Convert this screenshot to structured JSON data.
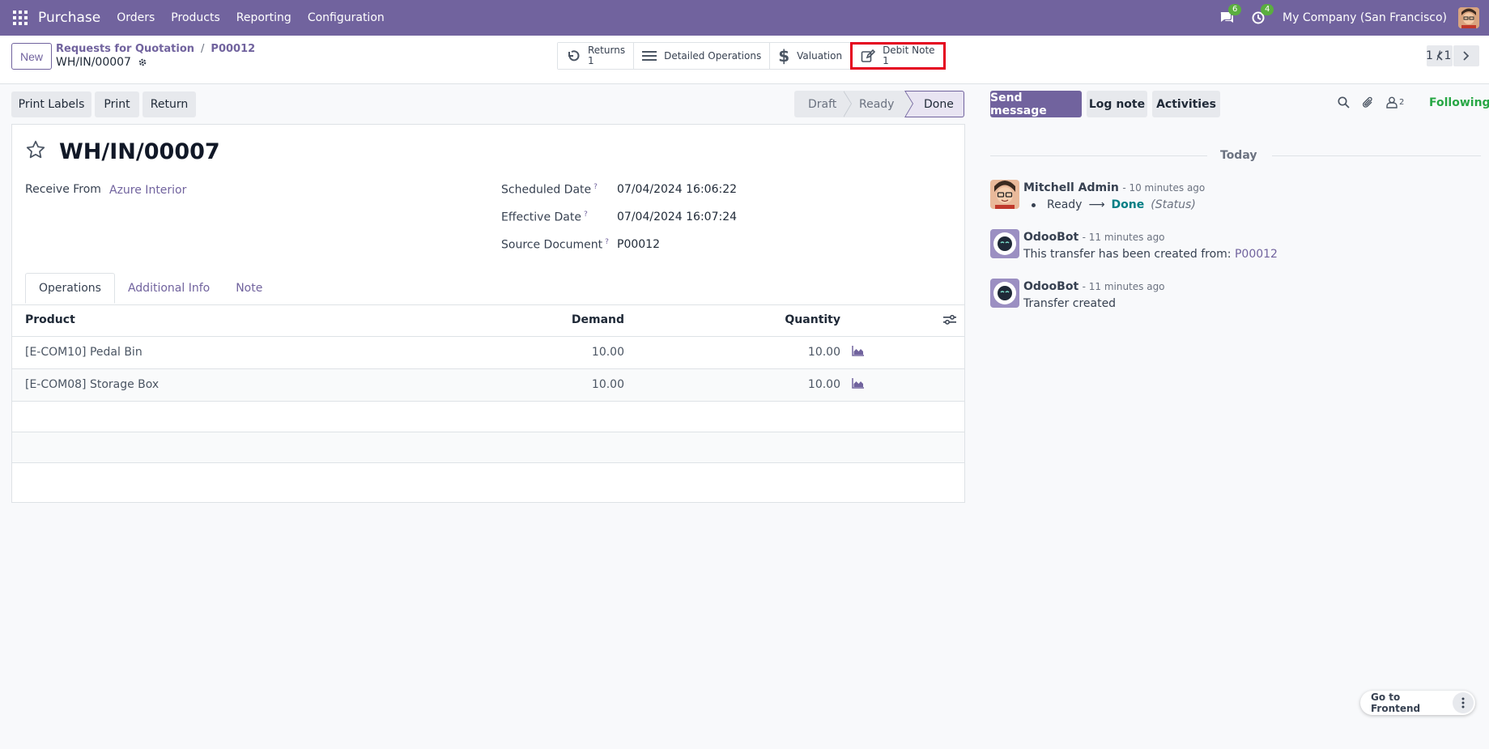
{
  "navbar": {
    "brand": "Purchase",
    "menu": [
      "Orders",
      "Products",
      "Reporting",
      "Configuration"
    ],
    "messages_count": "6",
    "activities_count": "4",
    "company": "My Company (San Francisco)"
  },
  "control": {
    "new_label": "New",
    "breadcrumb": [
      "Requests for Quotation",
      "P00012"
    ],
    "breadcrumb_sep": "/",
    "record_name": "WH/IN/00007",
    "smart_buttons": {
      "returns_label": "Returns",
      "returns_count": "1",
      "detailed_operations": "Detailed Operations",
      "valuation": "Valuation",
      "debit_note_label": "Debit Note",
      "debit_note_count": "1"
    },
    "pager": "1 / 1"
  },
  "actions": {
    "print_labels": "Print Labels",
    "print": "Print",
    "return": "Return"
  },
  "statusbar": {
    "stages": [
      "Draft",
      "Ready",
      "Done"
    ],
    "current": "Done"
  },
  "form": {
    "title": "WH/IN/00007",
    "receive_from_label": "Receive From",
    "receive_from": "Azure Interior",
    "scheduled_date_label": "Scheduled Date",
    "scheduled_date": "07/04/2024 16:06:22",
    "effective_date_label": "Effective Date",
    "effective_date": "07/04/2024 16:07:24",
    "source_document_label": "Source Document",
    "source_document": "P00012",
    "help_mark": "?",
    "tabs": [
      "Operations",
      "Additional Info",
      "Note"
    ],
    "table": {
      "headers": [
        "Product",
        "Demand",
        "Quantity"
      ],
      "rows": [
        {
          "product": "[E-COM10] Pedal Bin",
          "demand": "10.00",
          "quantity": "10.00"
        },
        {
          "product": "[E-COM08] Storage Box",
          "demand": "10.00",
          "quantity": "10.00"
        }
      ]
    }
  },
  "chatter": {
    "send_message": "Send message",
    "log_note": "Log note",
    "activities": "Activities",
    "followers_count": "2",
    "following": "Following",
    "date_separator": "Today",
    "messages": [
      {
        "author": "Mitchell Admin",
        "time": "- 10 minutes ago",
        "old_value": "Ready",
        "arrow": "⟶",
        "new_value": "Done",
        "field": "(Status)"
      },
      {
        "author": "OdooBot",
        "time": "- 11 minutes ago",
        "text": "This transfer has been created from: ",
        "link": "P00012"
      },
      {
        "author": "OdooBot",
        "time": "- 11 minutes ago",
        "text": "Transfer created"
      }
    ]
  },
  "footer": {
    "go_to_frontend": "Go to Frontend"
  },
  "colors": {
    "brand": "#71639e",
    "badge": "#5aae3f",
    "highlight": "#e4001f",
    "following": "#28a745"
  }
}
